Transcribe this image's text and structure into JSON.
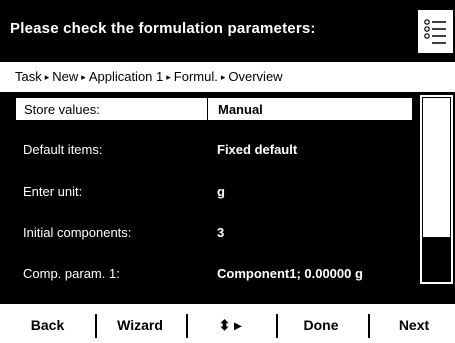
{
  "header": {
    "title": "Please check the formulation parameters:",
    "list_icon": "list-icon"
  },
  "breadcrumb": {
    "items": [
      "Task",
      "New",
      "Application 1",
      "Formul.",
      "Overview"
    ],
    "separator": "▸"
  },
  "parameters": [
    {
      "label": "Store values:",
      "value": "Manual",
      "selected": true
    },
    {
      "label": "Default items:",
      "value": "Fixed default",
      "selected": false
    },
    {
      "label": "Enter unit:",
      "value": "g",
      "selected": false
    },
    {
      "label": "Initial components:",
      "value": "3",
      "selected": false
    },
    {
      "label": "Comp. param. 1:",
      "value": "Component1; 0.00000 g",
      "selected": false
    }
  ],
  "scrollbar": {
    "position": 0,
    "visible_fraction": 0.73
  },
  "footer": {
    "back": "Back",
    "wizard": "Wizard",
    "nav_icon": "updown-right-arrows-icon",
    "nav_symbol": "⬍ ▸",
    "done": "Done",
    "next": "Next"
  }
}
